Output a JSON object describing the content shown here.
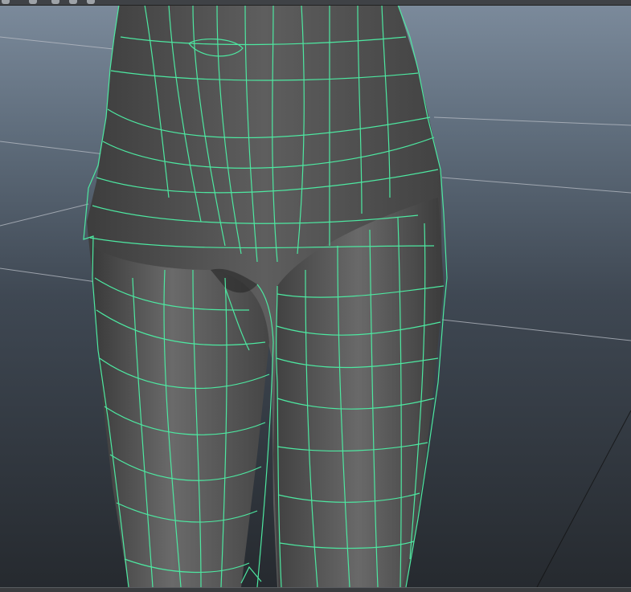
{
  "app": {
    "name": "3d-viewport"
  },
  "toolbar": {
    "icons": [
      "select-tool-icon",
      "lasso-tool-icon",
      "paint-tool-icon",
      "move-tool-icon",
      "rotate-tool-icon"
    ]
  },
  "viewport": {
    "view": "perspective",
    "shading": "smooth-shaded-with-wireframe-on-shaded",
    "selection_highlight_color": "#4de8a1",
    "mesh_color": "#5a5a5a",
    "background_top_color": "#7b8a9b",
    "background_bottom_color": "#262a2f",
    "grid_line_color": "#b9bec6"
  }
}
